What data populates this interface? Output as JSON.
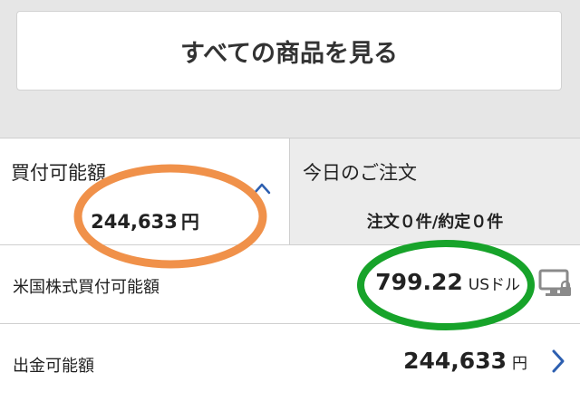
{
  "header": {
    "all_products_label": "すべての商品を見る"
  },
  "summary": {
    "buying_power": {
      "title": "買付可能額",
      "amount": "244,633",
      "unit": "円",
      "toggle_icon": "chevron-up-icon"
    },
    "orders_today": {
      "title": "今日のご注文",
      "status": "注文０件/約定０件"
    }
  },
  "rows": {
    "us_buying_power": {
      "label": "米国株式買付可能額",
      "amount": "799.22",
      "unit": "USドル",
      "icon": "monitor-lock-icon"
    },
    "withdrawable": {
      "label": "出金可能額",
      "amount": "244,633",
      "unit": "円",
      "icon": "chevron-right-icon"
    }
  },
  "annotations": {
    "orange_circle_color": "#f0914a",
    "green_circle_color": "#17a32a"
  },
  "colors": {
    "accent_blue": "#2d5fb0",
    "icon_gray": "#8a8a8a"
  }
}
